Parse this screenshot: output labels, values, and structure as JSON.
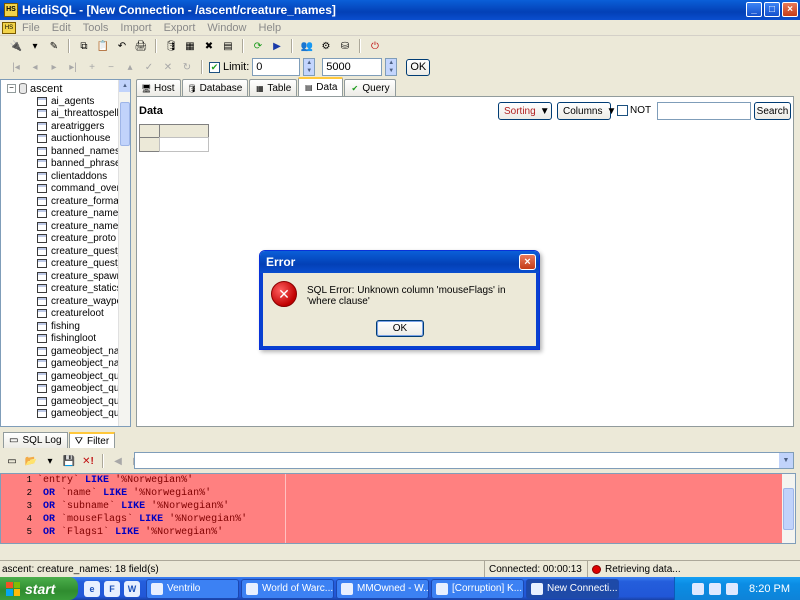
{
  "window": {
    "title": "HeidiSQL - [New Connection - /ascent/creature_names]",
    "app_icon_text": "HS"
  },
  "menu": [
    "File",
    "Edit",
    "Tools",
    "Import",
    "Export",
    "Window",
    "Help"
  ],
  "toolbar2": {
    "limit_label": "Limit:",
    "limit_offset": "0",
    "limit_count": "5000",
    "ok_label": "OK"
  },
  "tree": {
    "root": "ascent",
    "tables": [
      "ai_agents",
      "ai_threattospellid",
      "areatriggers",
      "auctionhouse",
      "banned_names",
      "banned_phrases",
      "clientaddons",
      "command_overrides",
      "creature_formations",
      "creature_names",
      "creature_names_l",
      "creature_proto",
      "creature_quest_fi",
      "creature_quest_st",
      "creature_spawns",
      "creature_staticspa",
      "creature_waypoin",
      "creatureloot",
      "fishing",
      "fishingloot",
      "gameobject_names",
      "gameobject_names",
      "gameobject_quest",
      "gameobject_quest",
      "gameobject_quest",
      "gameobject_quest"
    ]
  },
  "tabs": [
    {
      "label": "Host",
      "icon": "host-icon"
    },
    {
      "label": "Database",
      "icon": "database-icon"
    },
    {
      "label": "Table",
      "icon": "table-icon"
    },
    {
      "label": "Data",
      "icon": "data-icon"
    },
    {
      "label": "Query",
      "icon": "query-icon"
    }
  ],
  "data_panel": {
    "header": "Data",
    "sorting_label": "Sorting",
    "columns_label": "Columns",
    "not_label": "NOT",
    "search_label": "Search",
    "search_value": ""
  },
  "bottom_tabs": [
    {
      "label": "SQL Log"
    },
    {
      "label": "Filter"
    }
  ],
  "filter": {
    "combo_value": "",
    "lines": [
      {
        "num": "1",
        "col": "`entry`",
        "op": "LIKE",
        "val": "'%Norwegian%'",
        "prefix": ""
      },
      {
        "num": "2",
        "col": "`name`",
        "op": "LIKE",
        "val": "'%Norwegian%'",
        "prefix": "OR"
      },
      {
        "num": "3",
        "col": "`subname`",
        "op": "LIKE",
        "val": "'%Norwegian%'",
        "prefix": "OR"
      },
      {
        "num": "4",
        "col": "`mouseFlags`",
        "op": "LIKE",
        "val": "'%Norwegian%'",
        "prefix": "OR"
      },
      {
        "num": "5",
        "col": "`Flags1`",
        "op": "LIKE",
        "val": "'%Norwegian%'",
        "prefix": "OR"
      }
    ]
  },
  "status": {
    "table_info": "ascent: creature_names: 18 field(s)",
    "connected": "Connected: 00:00:13",
    "activity": "Retrieving data..."
  },
  "dialog": {
    "title": "Error",
    "message": "SQL Error: Unknown column 'mouseFlags' in 'where clause'",
    "ok_label": "OK"
  },
  "taskbar": {
    "start_label": "start",
    "quicklaunch": [
      "e",
      "F",
      "W"
    ],
    "tasks": [
      {
        "label": "Ventrilo",
        "active": false
      },
      {
        "label": "World of Warc...",
        "active": false
      },
      {
        "label": "MMOwned - W...",
        "active": false
      },
      {
        "label": "[Corruption] K...",
        "active": false
      },
      {
        "label": "New Connecti...",
        "active": true
      }
    ],
    "clock": "8:20 PM"
  },
  "colors": {
    "titlebar": "#0a4ecf",
    "filter_bg": "#ff8080",
    "error_icon": "#c00000"
  }
}
